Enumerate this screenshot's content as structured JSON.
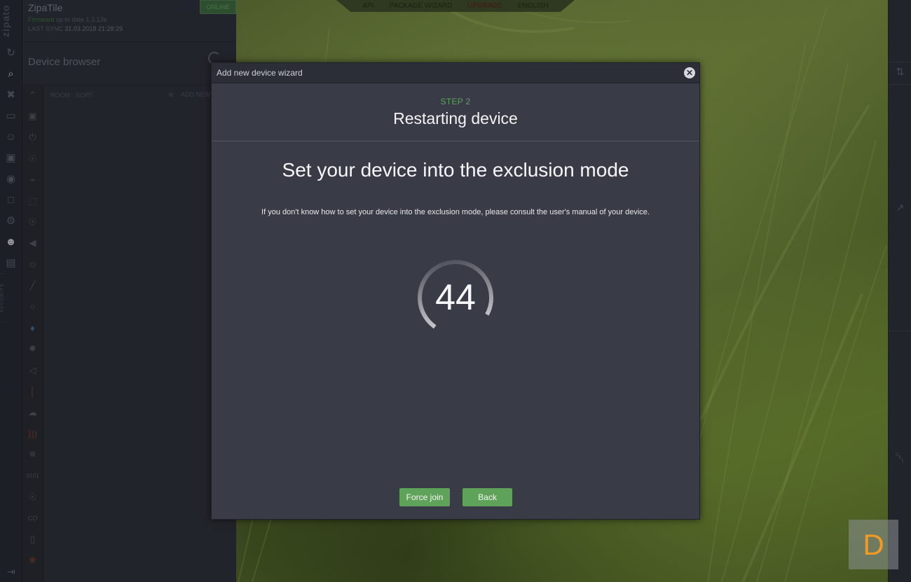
{
  "app": {
    "logo": "zipato",
    "name": "ZipaTile",
    "status": "ONLINE"
  },
  "firmware": {
    "label": "Firmware",
    "text": "up to date 1.3.13e"
  },
  "sync": {
    "label": "LAST SYNC",
    "value": "31.03.2018 21:28:29"
  },
  "device_browser": {
    "title": "Device browser",
    "room_label": "ROOM",
    "sort_label": "SORT",
    "add_label": "ADD NEW DE"
  },
  "favorite_label": "FAVORITE",
  "topnav": {
    "items": [
      "API",
      "PACKAGE WIZARD",
      "UPGRADE",
      "ENGLISH"
    ]
  },
  "modal": {
    "title": "Add new device wizard",
    "step": "STEP 2",
    "step_title": "Restarting device",
    "headline": "Set your device into the exclusion mode",
    "help": "If you don't know how to set your device into the exclusion mode, please consult the user's manual of your device.",
    "countdown": "44",
    "countdown_progress": 0.73,
    "buttons": {
      "force_join": "Force join",
      "back": "Back"
    }
  },
  "watermark": "D",
  "colors": {
    "accent_green": "#5fa35b",
    "upgrade_red": "#5e1e14",
    "watermark_orange": "#f39a22"
  }
}
